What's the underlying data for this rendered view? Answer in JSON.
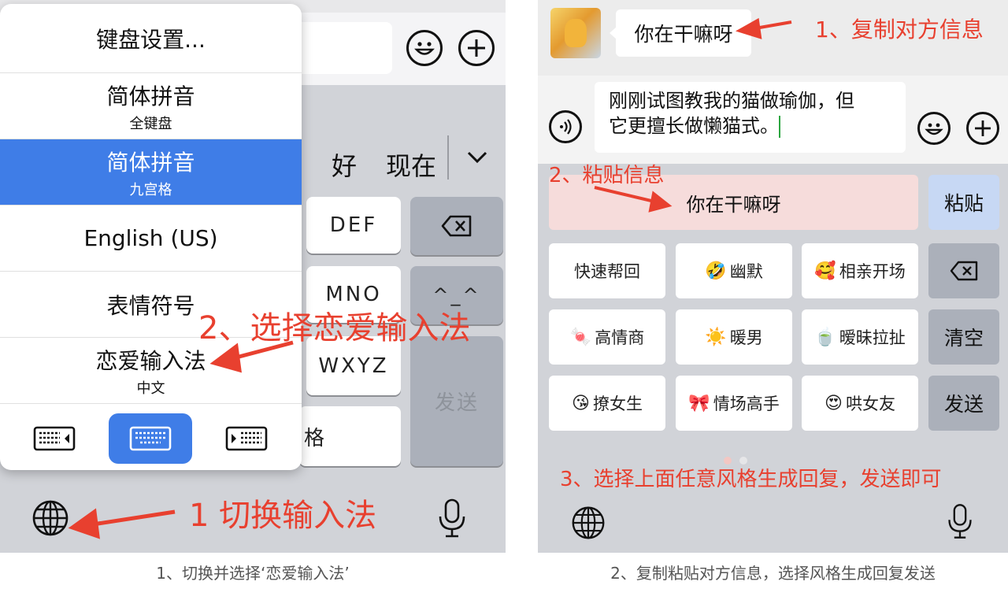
{
  "left": {
    "candidates": [
      "好",
      "现在"
    ],
    "keys": {
      "def": "DEF",
      "mno": "MNO",
      "emoticon": "^_^",
      "wxyz": "WXYZ",
      "send": "发送",
      "ge": "格"
    },
    "ime_menu": {
      "settings": "键盘设置...",
      "items": [
        {
          "main": "简体拼音",
          "sub": "全键盘"
        },
        {
          "main": "简体拼音",
          "sub": "九宫格"
        },
        {
          "main": "English (US)",
          "sub": ""
        },
        {
          "main": "表情符号",
          "sub": ""
        },
        {
          "main": "恋爱输入法",
          "sub": "中文"
        }
      ],
      "selected_index": 1
    },
    "annotations": {
      "step1": "1 切换输入法",
      "step2": "2、选择恋爱输入法"
    },
    "caption": "1、切换并选择‘恋爱输入法’"
  },
  "right": {
    "chat_message": "你在干嘛呀",
    "input_text_line1": "刚刚试图教我的猫做瑜伽，但",
    "input_text_line2": "它更擅长做懒猫式。",
    "paste_content": "你在干嘛呀",
    "paste_button": "粘贴",
    "styles": [
      {
        "icon": "",
        "label": "快速帮回"
      },
      {
        "icon": "🤣",
        "label": "幽默"
      },
      {
        "icon": "🥰",
        "label": "相亲开场"
      },
      {
        "icon": "🍬",
        "label": "高情商"
      },
      {
        "icon": "☀️",
        "label": "暖男"
      },
      {
        "icon": "🍵",
        "label": "暧昧拉扯"
      },
      {
        "icon": "😘",
        "label": "撩女生"
      },
      {
        "icon": "🎀",
        "label": "情场高手"
      },
      {
        "icon": "😍",
        "label": "哄女友"
      }
    ],
    "side_keys": {
      "clear": "清空",
      "send": "发送"
    },
    "annotations": {
      "step1": "1、复制对方信息",
      "step2": "2、粘贴信息",
      "step3": "3、选择上面任意风格生成回复，发送即可"
    },
    "caption": "2、复制粘贴对方信息，选择风格生成回复发送"
  },
  "colors": {
    "accent_blue": "#3f7de7",
    "annotation_red": "#e8402f",
    "keyboard_bg": "#d1d3d8",
    "paste_bg": "#f6dcdb"
  }
}
